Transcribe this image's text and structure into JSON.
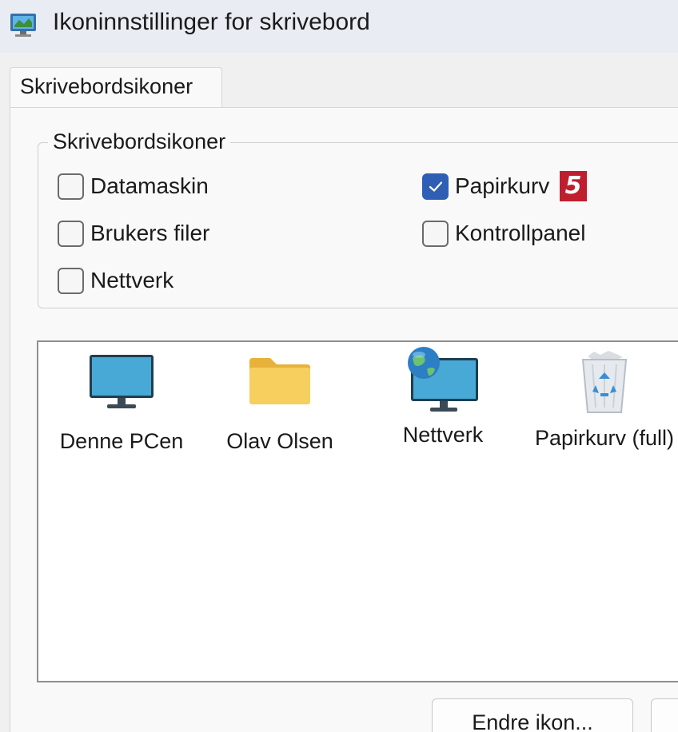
{
  "window": {
    "title": "Ikoninnstillinger for skrivebord",
    "icon": "display-settings-icon"
  },
  "tabs": [
    {
      "label": "Skrivebordsikoner",
      "selected": true
    }
  ],
  "desktop_icons_group": {
    "legend": "Skrivebordsikoner",
    "checkboxes": [
      {
        "label": "Datamaskin",
        "checked": false
      },
      {
        "label": "Papirkurv",
        "checked": true
      },
      {
        "label": "Brukers filer",
        "checked": false
      },
      {
        "label": "Kontrollpanel",
        "checked": false
      },
      {
        "label": "Nettverk",
        "checked": false
      }
    ]
  },
  "annotation": {
    "step": "5",
    "color": "#bf1e2e"
  },
  "icon_list": [
    {
      "label": "Denne PCen",
      "icon": "monitor-icon"
    },
    {
      "label": "Olav Olsen",
      "icon": "folder-icon"
    },
    {
      "label": "Nettverk",
      "icon": "network-globe-icon"
    },
    {
      "label": "Papirkurv (full)",
      "icon": "recycle-bin-full-icon"
    }
  ],
  "buttons": {
    "change_icon": "Endre ikon..."
  },
  "colors": {
    "accent": "#2f5fb4",
    "titlebar": "#e9edf3"
  }
}
